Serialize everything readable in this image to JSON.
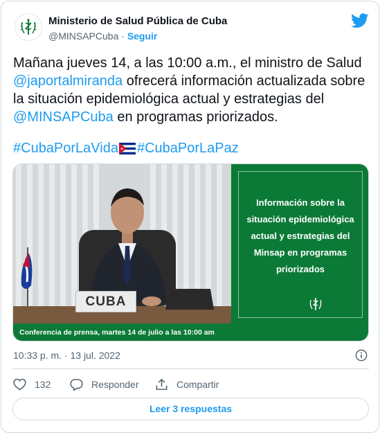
{
  "author": {
    "name": "Ministerio de Salud Pública de Cuba",
    "handle": "@MINSAPCuba",
    "separator": "·",
    "follow_label": "Seguir"
  },
  "tweet": {
    "line1_prefix": "Mañana jueves 14, a las 10:00 a.m., el ministro de Salud",
    "mention1": "@japortalmiranda",
    "line2_rest": " ofrecerá información actualizada sobre",
    "line3": "la situación epidemiológica actual y estrategias del",
    "mention2": "@MINSAPCuba",
    "line4_rest": " en programas priorizados.",
    "hashtag1": "#CubaPorLaVida",
    "hashtag2": "#CubaPorLaPaz"
  },
  "media": {
    "panel_text": "Información sobre la situación epidemiológica actual y estrategias del Minsap en programas priorizados",
    "banner_text": "Conferencia de prensa, martes 14 de julio a las 10:00 am",
    "nameplate": "CUBA"
  },
  "footer": {
    "timestamp": "10:33 p. m. · 13 jul. 2022",
    "like_count": "132",
    "reply_label": "Responder",
    "share_label": "Compartir",
    "read_replies_label": "Leer 3 respuestas"
  },
  "icons": {
    "twitter": "twitter-bird-icon",
    "info": "info-icon",
    "like": "heart-icon",
    "reply": "speech-bubble-icon",
    "share": "share-icon"
  },
  "colors": {
    "accent": "#1d9bf0",
    "panel_green": "#0c7a37",
    "muted_text": "#536471",
    "border": "#cfd9de"
  }
}
